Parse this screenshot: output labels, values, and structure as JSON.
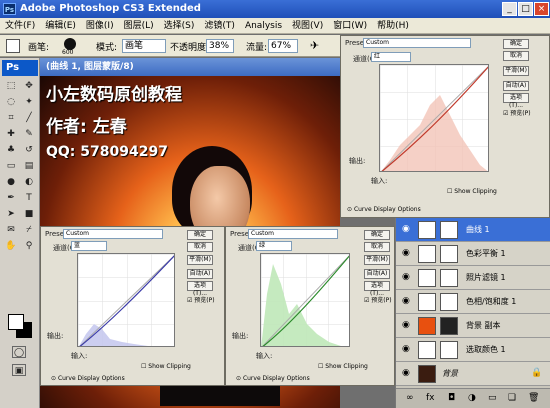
{
  "app": {
    "title": "Adobe Photoshop CS3 Extended"
  },
  "menu": [
    "文件(F)",
    "编辑(E)",
    "图像(I)",
    "图层(L)",
    "选择(S)",
    "滤镜(T)",
    "Analysis",
    "视图(V)",
    "窗口(W)",
    "帮助(H)"
  ],
  "options": {
    "brush_label": "画笔:",
    "brush_size": "600",
    "mode_label": "模式:",
    "mode_value": "画笔",
    "opacity_label": "不透明度:",
    "opacity_value": "38%",
    "flow_label": "流量:",
    "flow_value": "67%"
  },
  "document": {
    "title": "(曲线 1, 图层蒙版/8)",
    "lines": [
      "小左数码原创教程",
      "作者: 左春",
      "QQ: 578094297"
    ]
  },
  "curves_top": {
    "preset_label": "Preset:",
    "preset_value": "Custom",
    "channel_label": "通道(C):",
    "channel_value": "红",
    "ok": "确定",
    "cancel": "取消",
    "smooth": "平滑(M)",
    "auto": "自动(A)",
    "options": "选项(T)...",
    "preview": "预览(P)",
    "output": "输出:",
    "input": "输入:",
    "show_clipping": "Show Clipping",
    "curve_display": "Curve Display Options"
  },
  "curves_blue": {
    "preset_label": "Preset:",
    "preset_value": "Custom",
    "channel_label": "通道(C):",
    "channel_value": "蓝",
    "ok": "确定",
    "cancel": "取消",
    "smooth": "平滑(M)",
    "auto": "自动(A)",
    "options": "选项(T)...",
    "preview": "预览(P)",
    "output": "输出:",
    "input": "输入:",
    "show_clipping": "Show Clipping",
    "curve_display": "Curve Display Options"
  },
  "curves_green": {
    "preset_label": "Preset:",
    "preset_value": "Custom",
    "channel_label": "通道(C):",
    "channel_value": "绿",
    "ok": "确定",
    "cancel": "取消",
    "smooth": "平滑(M)",
    "auto": "自动(A)",
    "options": "选项(T)...",
    "preview": "预览(P)",
    "output": "输出:",
    "input": "输入:",
    "show_clipping": "Show Clipping",
    "curve_display": "Curve Display Options"
  },
  "layers": [
    {
      "name": "曲线 1",
      "active": true
    },
    {
      "name": "色彩平衡 1",
      "active": false
    },
    {
      "name": "照片滤镜 1",
      "active": false
    },
    {
      "name": "色相/饱和度 1",
      "active": false
    },
    {
      "name": "背景 副本",
      "active": false
    },
    {
      "name": "选取颜色 1",
      "active": false
    },
    {
      "name": "背景",
      "active": false
    }
  ],
  "colors": {
    "title_blue": "#1f4fb8",
    "doc_blue": "#3d6cc3",
    "active_layer": "#3a6fd6"
  }
}
